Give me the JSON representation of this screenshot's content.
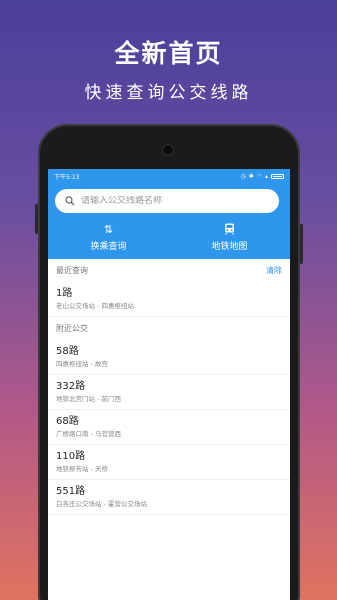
{
  "promo": {
    "title": "全新首页",
    "subtitle": "快速查询公交线路"
  },
  "status_bar": {
    "time": "下午5:13"
  },
  "search": {
    "placeholder": "请输入公交线路名称"
  },
  "quick_actions": [
    {
      "label": "换乘查询",
      "icon": "transfer-icon",
      "glyph": "⇅"
    },
    {
      "label": "地铁地图",
      "icon": "subway-icon",
      "glyph": "🚇"
    }
  ],
  "recent": {
    "header": "最近查询",
    "clear_label": "清除",
    "items": [
      {
        "name": "1路",
        "desc": "老山公交场站 - 四惠枢纽站"
      }
    ]
  },
  "nearby": {
    "header": "附近公交",
    "items": [
      {
        "name": "58路",
        "desc": "四惠枢纽站 - 故宫"
      },
      {
        "name": "332路",
        "desc": "地铁北宫门站 - 前门西"
      },
      {
        "name": "68路",
        "desc": "广桥路口南 - 马官营西"
      },
      {
        "name": "110路",
        "desc": "地铁柳芳站 - 天桥"
      },
      {
        "name": "551路",
        "desc": "白各庄公交场站 - 霍营公交场站"
      }
    ]
  },
  "tabs": [
    {
      "icon": "search-icon",
      "glyph": "⚲"
    },
    {
      "icon": "star-icon",
      "glyph": "☆"
    },
    {
      "icon": "more-icon",
      "glyph": "•••"
    }
  ],
  "colors": {
    "accent": "#2f96ee"
  }
}
